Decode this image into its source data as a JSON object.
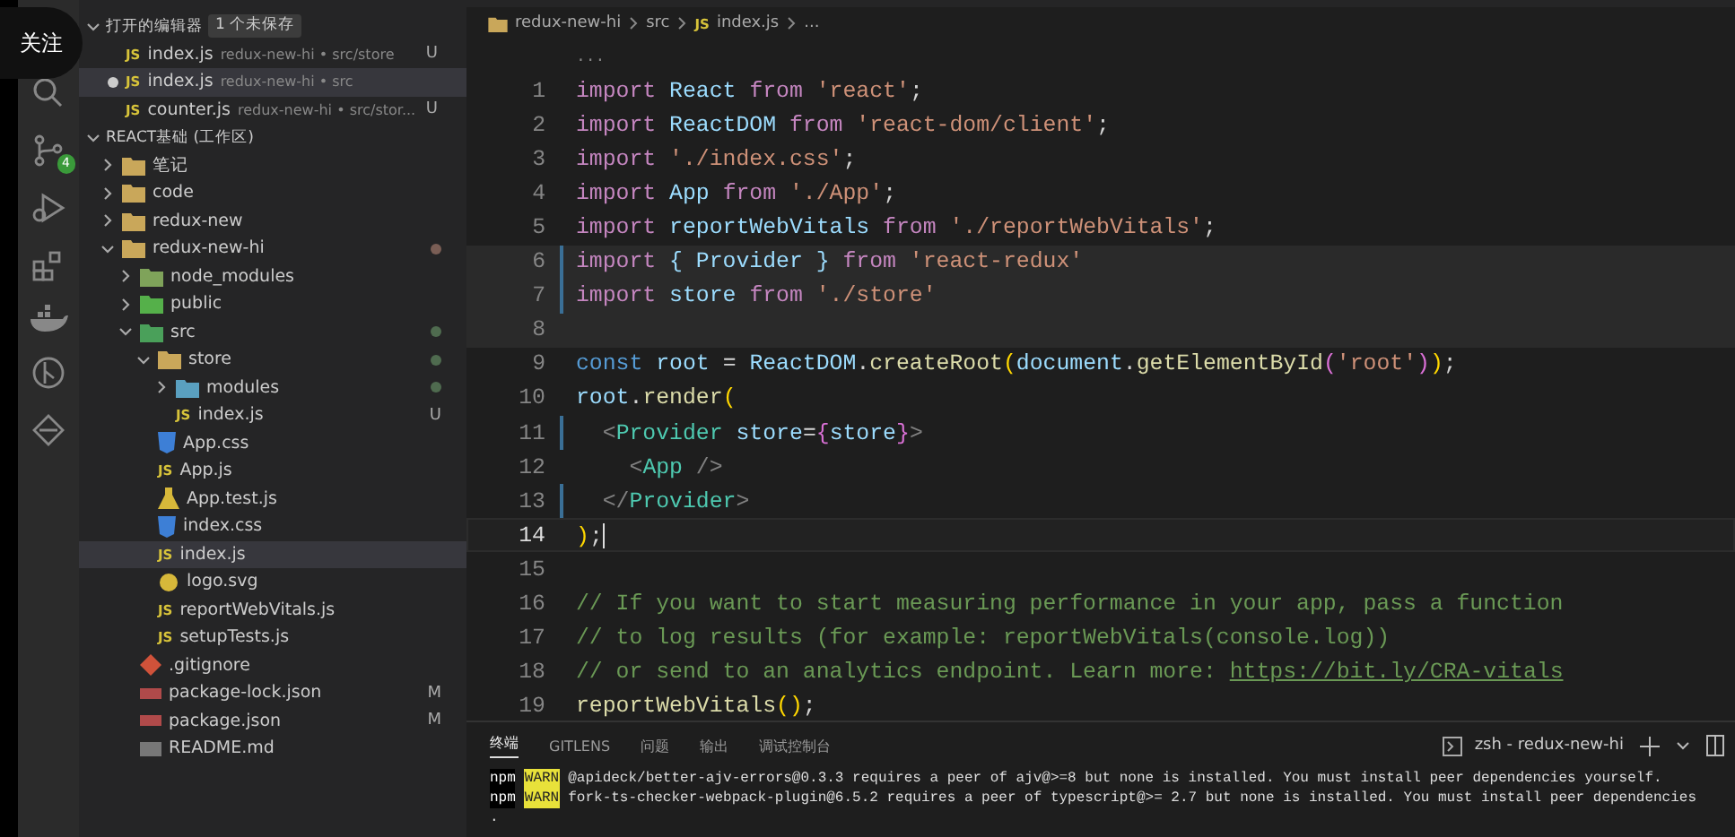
{
  "overlay": {
    "label": "关注"
  },
  "activity_bar": [
    {
      "kind": "search"
    },
    {
      "kind": "git",
      "badge": "4"
    },
    {
      "kind": "debug"
    },
    {
      "kind": "extensions"
    },
    {
      "kind": "docker"
    },
    {
      "kind": "gitlens"
    },
    {
      "kind": "remote"
    }
  ],
  "open_editors": {
    "title": "打开的编辑器",
    "unsaved": "1 个未保存",
    "items": [
      {
        "icon": "JS",
        "name": "index.js",
        "path": "redux-new-hi • src/store",
        "status": "U",
        "selected": false,
        "dirty": false
      },
      {
        "icon": "JS",
        "name": "index.js",
        "path": "redux-new-hi • src",
        "selected": true,
        "dirty": true
      },
      {
        "icon": "JS",
        "name": "counter.js",
        "path": "redux-new-hi • src/stor...",
        "status": "U",
        "selected": false,
        "dirty": false
      }
    ]
  },
  "explorer": {
    "title": "REACT基础 (工作区)",
    "tree": [
      {
        "name": "笔记",
        "kind": "folder",
        "expanded": false,
        "selected": false
      },
      {
        "name": "code",
        "kind": "folder",
        "expanded": false,
        "selected": false
      },
      {
        "name": "redux-new",
        "kind": "folder",
        "expanded": false,
        "selected": false
      },
      {
        "name": "redux-new-hi",
        "kind": "folder",
        "expanded": true,
        "selected": false,
        "color": "#7a5e55",
        "children": [
          {
            "name": "node_modules",
            "kind": "folder-node",
            "expanded": false,
            "selected": false
          },
          {
            "name": "public",
            "kind": "folder-public",
            "expanded": false,
            "selected": false
          },
          {
            "name": "src",
            "kind": "folder-src",
            "expanded": true,
            "selected": false,
            "color": "#4f6b4f",
            "children": [
              {
                "name": "store",
                "kind": "folder",
                "expanded": true,
                "selected": false,
                "color": "#4f6b4f",
                "children": [
                  {
                    "name": "modules",
                    "kind": "folder-modules",
                    "expanded": false,
                    "selected": false,
                    "color": "#4f6b4f"
                  },
                  {
                    "name": "index.js",
                    "kind": "js",
                    "icon": "JS",
                    "selected": false,
                    "status": "U"
                  }
                ]
              },
              {
                "name": "App.css",
                "kind": "css",
                "selected": false
              },
              {
                "name": "App.js",
                "kind": "js",
                "icon": "JS",
                "selected": false
              },
              {
                "name": "App.test.js",
                "kind": "test",
                "selected": false
              },
              {
                "name": "index.css",
                "kind": "css",
                "selected": false
              },
              {
                "name": "index.js",
                "kind": "js",
                "icon": "JS",
                "selected": true
              },
              {
                "name": "logo.svg",
                "kind": "svg",
                "selected": false
              },
              {
                "name": "reportWebVitals.js",
                "kind": "js",
                "icon": "JS",
                "selected": false
              },
              {
                "name": "setupTests.js",
                "kind": "js",
                "icon": "JS",
                "selected": false
              }
            ]
          },
          {
            "name": ".gitignore",
            "kind": "git",
            "selected": false
          },
          {
            "name": "package-lock.json",
            "kind": "json",
            "selected": false,
            "status": "M"
          },
          {
            "name": "package.json",
            "kind": "json",
            "selected": false,
            "status": "M"
          },
          {
            "name": "README.md",
            "kind": "md",
            "selected": false
          }
        ]
      }
    ]
  },
  "breadcrumbs": [
    {
      "label": "redux-new-hi",
      "kind": "folder"
    },
    {
      "label": "src",
      "kind": "plain"
    },
    {
      "label": "index.js",
      "kind": "js",
      "icon": "JS"
    },
    {
      "label": "...",
      "kind": "plain"
    }
  ],
  "editor": {
    "fold_hint": "...",
    "lines": [
      {
        "n": "1",
        "tokens": [
          {
            "text": "import",
            "kind": "kw"
          },
          {
            "text": " React ",
            "kind": "id"
          },
          {
            "text": "from",
            "kind": "kw"
          },
          {
            "text": " 'react'",
            "kind": "str"
          },
          {
            "text": ";",
            "kind": "p"
          }
        ]
      },
      {
        "n": "2",
        "tokens": [
          {
            "text": "import",
            "kind": "kw"
          },
          {
            "text": " ReactDOM ",
            "kind": "id"
          },
          {
            "text": "from",
            "kind": "kw"
          },
          {
            "text": " 'react-dom/client'",
            "kind": "str"
          },
          {
            "text": ";",
            "kind": "p"
          }
        ]
      },
      {
        "n": "3",
        "tokens": [
          {
            "text": "import",
            "kind": "kw"
          },
          {
            "text": " './index.css'",
            "kind": "str"
          },
          {
            "text": ";",
            "kind": "p"
          }
        ]
      },
      {
        "n": "4",
        "tokens": [
          {
            "text": "import",
            "kind": "kw"
          },
          {
            "text": " App ",
            "kind": "id"
          },
          {
            "text": "from",
            "kind": "kw"
          },
          {
            "text": " './App'",
            "kind": "str"
          },
          {
            "text": ";",
            "kind": "p"
          }
        ]
      },
      {
        "n": "5",
        "tokens": [
          {
            "text": "import",
            "kind": "kw"
          },
          {
            "text": " reportWebVitals ",
            "kind": "id"
          },
          {
            "text": "from",
            "kind": "kw"
          },
          {
            "text": " './reportWebVitals'",
            "kind": "str"
          },
          {
            "text": ";",
            "kind": "p"
          }
        ]
      },
      {
        "n": "6",
        "highlighted": true,
        "gutter": true,
        "tokens": [
          {
            "text": "import",
            "kind": "kw"
          },
          {
            "text": " { Provider } ",
            "kind": "id"
          },
          {
            "text": "from",
            "kind": "kw"
          },
          {
            "text": " 'react-redux'",
            "kind": "str"
          }
        ]
      },
      {
        "n": "7",
        "highlighted": true,
        "gutter": true,
        "tokens": [
          {
            "text": "import",
            "kind": "kw"
          },
          {
            "text": " store ",
            "kind": "id"
          },
          {
            "text": "from",
            "kind": "kw"
          },
          {
            "text": " './store'",
            "kind": "str"
          }
        ]
      },
      {
        "n": "8",
        "highlighted": true
      },
      {
        "n": "9",
        "tokens": [
          {
            "text": "const",
            "kind": "decl"
          },
          {
            "text": " root ",
            "kind": "id"
          },
          {
            "text": "= ",
            "kind": "p"
          },
          {
            "text": "ReactDOM",
            "kind": "id"
          },
          {
            "text": ".",
            "kind": "p"
          },
          {
            "text": "createRoot",
            "kind": "fn"
          },
          {
            "text": "(",
            "kind": "brace"
          },
          {
            "text": "document",
            "kind": "id"
          },
          {
            "text": ".",
            "kind": "p"
          },
          {
            "text": "getElementById",
            "kind": "fn"
          },
          {
            "text": "(",
            "kind": "br2"
          },
          {
            "text": "'root'",
            "kind": "str"
          },
          {
            "text": ")",
            "kind": "br2"
          },
          {
            "text": ")",
            "kind": "brace"
          },
          {
            "text": ";",
            "kind": "p"
          }
        ]
      },
      {
        "n": "10",
        "tokens": [
          {
            "text": "root",
            "kind": "id"
          },
          {
            "text": ".",
            "kind": "p"
          },
          {
            "text": "render",
            "kind": "fn"
          },
          {
            "text": "(",
            "kind": "brace"
          }
        ]
      },
      {
        "n": "11",
        "gutter": true,
        "tokens": [
          {
            "text": "  <",
            "kind": "angle"
          },
          {
            "text": "Provider",
            "kind": "tag"
          },
          {
            "text": " store",
            "kind": "id"
          },
          {
            "text": "=",
            "kind": "p"
          },
          {
            "text": "{",
            "kind": "br2"
          },
          {
            "text": "store",
            "kind": "id"
          },
          {
            "text": "}",
            "kind": "br2"
          },
          {
            "text": ">",
            "kind": "angle"
          }
        ]
      },
      {
        "n": "12",
        "tokens": [
          {
            "text": "    <",
            "kind": "angle"
          },
          {
            "text": "App",
            "kind": "tag"
          },
          {
            "text": " />",
            "kind": "angle"
          }
        ]
      },
      {
        "n": "13",
        "gutter": true,
        "tokens": [
          {
            "text": "  </",
            "kind": "angle"
          },
          {
            "text": "Provider",
            "kind": "tag"
          },
          {
            "text": ">",
            "kind": "angle"
          }
        ]
      },
      {
        "n": "14",
        "current": true,
        "tokens": [
          {
            "text": ")",
            "kind": "brace"
          },
          {
            "text": ";",
            "kind": "p"
          }
        ]
      },
      {
        "n": "15"
      },
      {
        "n": "16",
        "tokens": [
          {
            "text": "// If you want to start measuring performance in your app, pass a function",
            "kind": "comment"
          }
        ]
      },
      {
        "n": "17",
        "tokens": [
          {
            "text": "// to log results (for example: reportWebVitals(console.log))",
            "kind": "comment"
          }
        ]
      },
      {
        "n": "18",
        "tokens": [
          {
            "text": "// or send to an analytics endpoint. Learn more: ",
            "kind": "comment"
          },
          {
            "text": "https://bit.ly/CRA-vitals",
            "kind": "link"
          }
        ]
      },
      {
        "n": "19",
        "tokens": [
          {
            "text": "reportWebVitals",
            "kind": "fn"
          },
          {
            "text": "(",
            "kind": "brace"
          },
          {
            "text": ")",
            "kind": "brace"
          },
          {
            "text": ";",
            "kind": "p"
          }
        ]
      }
    ]
  },
  "panel": {
    "tabs": [
      {
        "label": "终端",
        "selected": true
      },
      {
        "label": "GITLENS",
        "selected": false
      },
      {
        "label": "问题",
        "selected": false
      },
      {
        "label": "输出",
        "selected": false
      },
      {
        "label": "调试控制台",
        "selected": false
      }
    ],
    "terminal_name": "zsh - redux-new-hi",
    "lines": [
      {
        "prefix": "npm",
        "level": "WARN",
        "text": "@apideck/better-ajv-errors@0.3.3 requires a peer of ajv@>=8 but none is installed. You must install peer dependencies yourself."
      },
      {
        "prefix": "npm",
        "level": "WARN",
        "text": "fork-ts-checker-webpack-plugin@6.5.2 requires a peer of typescript@>= 2.7 but none is installed. You must install peer dependencies"
      },
      {
        "text": "."
      }
    ]
  }
}
